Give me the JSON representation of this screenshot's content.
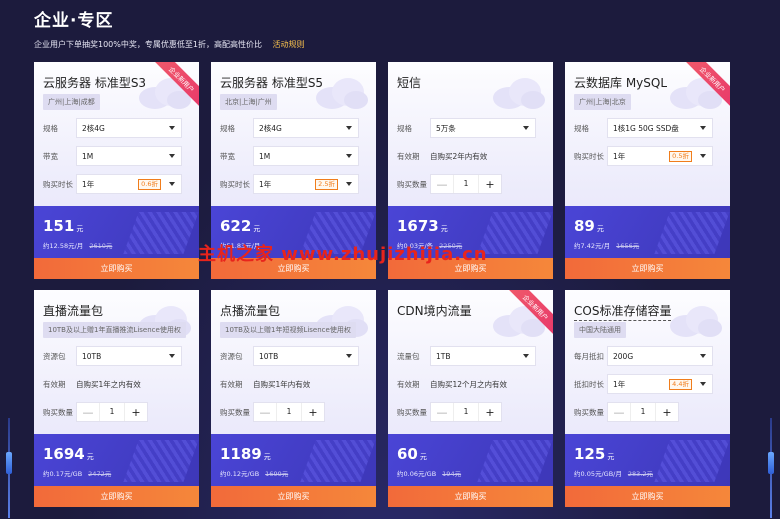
{
  "header": {
    "title": "企业·专区",
    "subtitle": "企业用户下单抽奖100%中奖，专属优惠低至1折，高配高性价比",
    "rule_link": "活动规则"
  },
  "watermark": "主机之家 www.zhujizhijia.cn",
  "colors": {
    "accent": "#4a45d6",
    "buy": "#f26a3a",
    "discount": "#f07d1c",
    "background": "#1c1b3d"
  },
  "cards": [
    {
      "title": "云服务器 标准型S3",
      "region": "广州|上海|成都",
      "ribbon": "企业新用户",
      "rows": [
        {
          "type": "select",
          "label": "规格",
          "value": "2核4G"
        },
        {
          "type": "select",
          "label": "带宽",
          "value": "1M"
        },
        {
          "type": "select",
          "label": "购买时长",
          "value": "1年",
          "discount": "0.6折"
        }
      ],
      "price": "151",
      "unit": "元",
      "sub": "约12.58元/月",
      "orig": "2610元",
      "buy": "立即购买"
    },
    {
      "title": "云服务器 标准型S5",
      "region": "北京|上海|广州",
      "ribbon": "",
      "rows": [
        {
          "type": "select",
          "label": "规格",
          "value": "2核4G"
        },
        {
          "type": "select",
          "label": "带宽",
          "value": "1M"
        },
        {
          "type": "select",
          "label": "购买时长",
          "value": "1年",
          "discount": "2.5折"
        }
      ],
      "price": "622",
      "unit": "元",
      "sub": "约51.83元/月",
      "orig": "",
      "buy": "立即购买"
    },
    {
      "title": "短信",
      "region": "",
      "ribbon": "",
      "rows": [
        {
          "type": "select",
          "label": "规格",
          "value": "5万条"
        },
        {
          "type": "text",
          "label": "有效期",
          "value": "自购买2年内有效"
        },
        {
          "type": "stepper",
          "label": "购买数量",
          "value": "1"
        }
      ],
      "price": "1673",
      "unit": "元",
      "sub": "约0.03元/条",
      "orig": "2250元",
      "buy": "立即购买"
    },
    {
      "title": "云数据库 MySQL",
      "region": "广州|上海|北京",
      "ribbon": "企业新用户",
      "rows": [
        {
          "type": "select",
          "label": "规格",
          "value": "1核1G 50G SSD盘"
        },
        {
          "type": "select",
          "label": "购买时长",
          "value": "1年",
          "discount": "0.5折"
        }
      ],
      "price": "89",
      "unit": "元",
      "sub": "约7.42元/月",
      "orig": "1656元",
      "buy": "立即购买"
    },
    {
      "title": "直播流量包",
      "region": "10TB及以上赠1年直播推流Lisence使用权",
      "ribbon": "",
      "rows": [
        {
          "type": "select",
          "label": "资源包",
          "value": "10TB"
        },
        {
          "type": "text",
          "label": "有效期",
          "value": "自购买1年之内有效"
        },
        {
          "type": "stepper",
          "label": "购买数量",
          "value": "1"
        }
      ],
      "price": "1694",
      "unit": "元",
      "sub": "约0.17元/GB",
      "orig": "2472元",
      "buy": "立即购买"
    },
    {
      "title": "点播流量包",
      "region": "10TB及以上赠1年短视频Lisence使用权",
      "ribbon": "",
      "rows": [
        {
          "type": "select",
          "label": "资源包",
          "value": "10TB"
        },
        {
          "type": "text",
          "label": "有效期",
          "value": "自购买1年内有效"
        },
        {
          "type": "stepper",
          "label": "购买数量",
          "value": "1"
        }
      ],
      "price": "1189",
      "unit": "元",
      "sub": "约0.12元/GB",
      "orig": "1699元",
      "buy": "立即购买"
    },
    {
      "title": "CDN境内流量",
      "region": "",
      "ribbon": "企业新用户",
      "rows": [
        {
          "type": "select",
          "label": "流量包",
          "value": "1TB"
        },
        {
          "type": "text",
          "label": "有效期",
          "value": "自购买12个月之内有效"
        },
        {
          "type": "stepper",
          "label": "购买数量",
          "value": "1"
        }
      ],
      "price": "60",
      "unit": "元",
      "sub": "约0.06元/GB",
      "orig": "194元",
      "buy": "立即购买"
    },
    {
      "title": "COS标准存储容量",
      "region": "中国大陆通用",
      "ribbon": "",
      "rows": [
        {
          "type": "select",
          "label": "每月抵扣",
          "value": "200G"
        },
        {
          "type": "select",
          "label": "抵扣时长",
          "value": "1年",
          "discount": "4.4折"
        },
        {
          "type": "stepper",
          "label": "购买数量",
          "value": "1"
        }
      ],
      "price": "125",
      "unit": "元",
      "sub": "约0.05元/GB/月",
      "orig": "283.2元",
      "buy": "立即购买"
    }
  ]
}
